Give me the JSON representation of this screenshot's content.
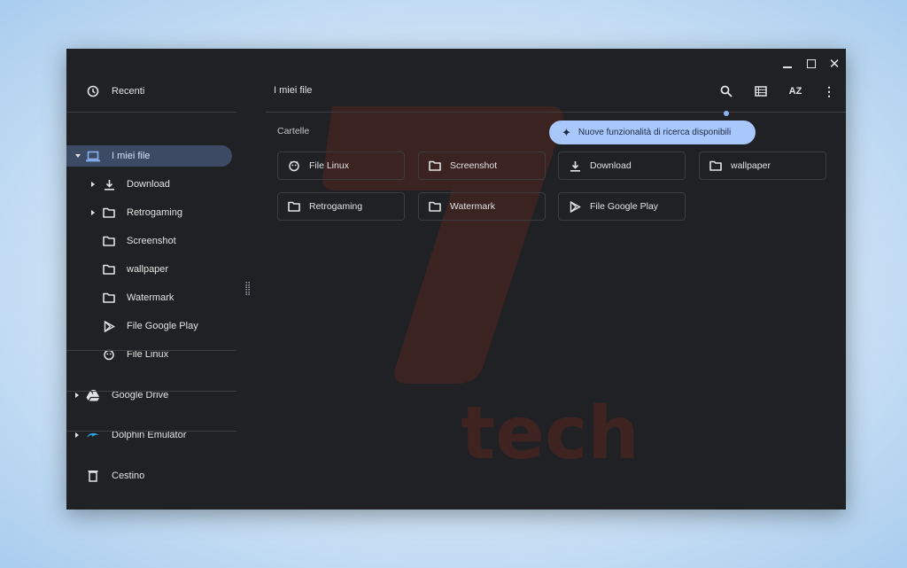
{
  "window": {
    "controls": [
      "minimize",
      "maximize",
      "close"
    ]
  },
  "sidebar": {
    "recent": {
      "label": "Recenti",
      "icon": "clock-icon"
    },
    "my_files": {
      "label": "I miei file",
      "icon": "laptop-icon"
    },
    "children": [
      {
        "label": "Download",
        "icon": "download-icon",
        "expandable": true
      },
      {
        "label": "Retrogaming",
        "icon": "folder-icon",
        "expandable": true
      },
      {
        "label": "Screenshot",
        "icon": "folder-icon",
        "expandable": false
      },
      {
        "label": "wallpaper",
        "icon": "folder-icon",
        "expandable": false
      },
      {
        "label": "Watermark",
        "icon": "folder-icon",
        "expandable": false
      },
      {
        "label": "File Google Play",
        "icon": "play-icon",
        "expandable": false
      },
      {
        "label": "File Linux",
        "icon": "linux-icon",
        "expandable": false
      }
    ],
    "roots": [
      {
        "label": "Google Drive",
        "icon": "drive-icon"
      },
      {
        "label": "Dolphin Emulator",
        "icon": "dolphin-icon"
      }
    ],
    "trash": {
      "label": "Cestino",
      "icon": "trash-icon"
    }
  },
  "main": {
    "title": "I miei file",
    "toolbar": [
      "search-icon",
      "list-view-icon",
      "sort-az-icon",
      "more-vert-icon"
    ],
    "section": "Cartelle",
    "tooltip": "Nuove funzionalità di ricerca disponibili",
    "folders": [
      {
        "label": "File Linux",
        "icon": "linux-icon"
      },
      {
        "label": "Screenshot",
        "icon": "folder-icon"
      },
      {
        "label": "Download",
        "icon": "download-icon"
      },
      {
        "label": "wallpaper",
        "icon": "folder-icon"
      },
      {
        "label": "Retrogaming",
        "icon": "folder-icon"
      },
      {
        "label": "Watermark",
        "icon": "folder-icon"
      },
      {
        "label": "File Google Play",
        "icon": "play-icon"
      }
    ]
  },
  "watermark": {
    "text": "tech",
    "color": "#7a2a22"
  },
  "colors": {
    "accent": "#a8c7fa",
    "selected": "#3d4a63",
    "background": "#202124"
  }
}
